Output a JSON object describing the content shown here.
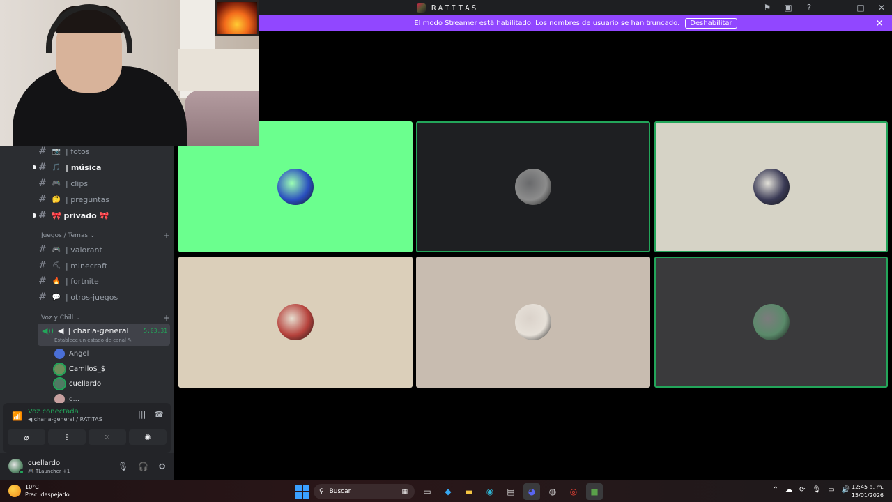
{
  "window": {
    "server_name": "RATITAS",
    "icons": [
      "inbox-icon",
      "screen-share-icon",
      "help-icon",
      "minimize-icon",
      "maximize-icon",
      "close-icon"
    ]
  },
  "banner": {
    "text": "El modo Streamer está habilitado. Los nombres de usuario se han truncado.",
    "button": "Deshabilitar",
    "bg": "#9147ff"
  },
  "channels": {
    "text": [
      {
        "emoji": "📷",
        "name": "| fotos",
        "unread": false
      },
      {
        "emoji": "🎵",
        "name": "| música",
        "unread": true
      },
      {
        "emoji": "🎮",
        "name": "| clips",
        "unread": false
      },
      {
        "emoji": "🤔",
        "name": "| preguntas",
        "unread": false
      },
      {
        "emoji": "",
        "name": "🎀 privado 🎀",
        "unread": true
      }
    ],
    "category_games": "Juegos / Temas",
    "games": [
      {
        "emoji": "🎮",
        "name": "| valorant"
      },
      {
        "emoji": "⛏",
        "name": "| minecraft"
      },
      {
        "emoji": "🔥",
        "name": "| fortnite"
      },
      {
        "emoji": "💬",
        "name": "| otros-juegos"
      }
    ],
    "category_voice": "Voz y Chill",
    "voice_channel": {
      "name": "| charla-general",
      "time": "5:03:31",
      "status": "Establece un estado de canal"
    },
    "voice_users": [
      {
        "name": "Angel",
        "color": "#4a6fd6"
      },
      {
        "name": "Camilo$_$",
        "color": "#6b8f5a"
      },
      {
        "name": "cuellardo",
        "color": "#4f7a63"
      },
      {
        "name": "c...",
        "color": "#c7a0a0"
      }
    ]
  },
  "voice_panel": {
    "title": "Voz conectada",
    "subtitle": "charla-general / RATITAS"
  },
  "user_panel": {
    "name": "cuellardo",
    "status": "TLauncher +1"
  },
  "tiles": [
    {
      "bg": "#6bff8e",
      "speaking": false,
      "avatar": "#2a4fbf"
    },
    {
      "bg": "#1e1f22",
      "speaking": true,
      "avatar": "#8c8c8c"
    },
    {
      "bg": "#d6d3c6",
      "speaking": true,
      "avatar": "#3a3a55"
    },
    {
      "bg": "#dbcfba",
      "speaking": false,
      "avatar": "#b6423c"
    },
    {
      "bg": "#c8bcb0",
      "speaking": false,
      "avatar": "#e6e0d8"
    },
    {
      "bg": "#3a3a3c",
      "speaking": true,
      "avatar": "#5a8a6a"
    }
  ],
  "taskbar": {
    "temp": "10°C",
    "weather": "Prac. despejado",
    "search": "Buscar",
    "time": "12:45 a. m.",
    "date": "15/01/2026"
  }
}
